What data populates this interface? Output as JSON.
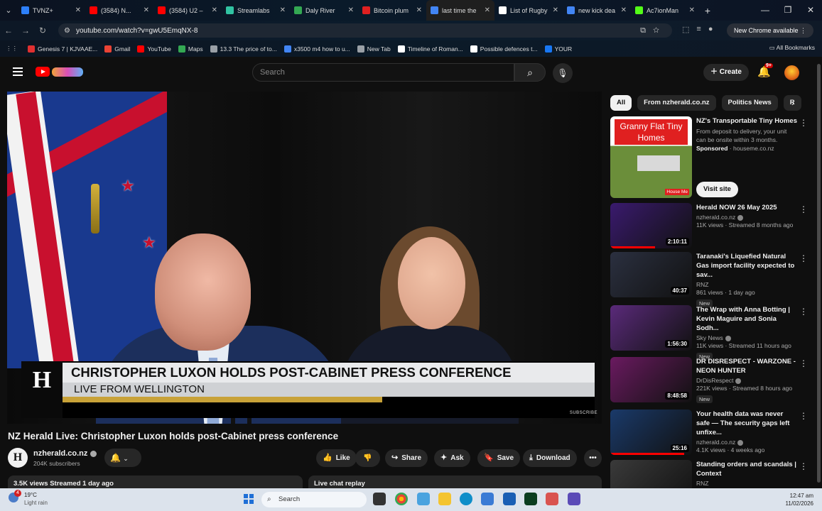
{
  "browser": {
    "tabs": [
      {
        "title": "TVNZ+",
        "color": "#2d7ff9"
      },
      {
        "title": "(3584) N...",
        "color": "#ff0000"
      },
      {
        "title": "(3584) U2 –",
        "color": "#ff0000"
      },
      {
        "title": "Streamlabs",
        "color": "#31c3a2"
      },
      {
        "title": "Daly River",
        "color": "#34a853"
      },
      {
        "title": "Bitcoin plum",
        "color": "#e02020"
      },
      {
        "title": "last time the",
        "color": "#4285f4"
      },
      {
        "title": "List of Rugby",
        "color": "#ffffff"
      },
      {
        "title": "new kick dea",
        "color": "#4285f4"
      },
      {
        "title": "Ac7ionMan",
        "color": "#53fc18"
      }
    ],
    "url": "youtube.com/watch?v=gwU5EmqNX-8",
    "new_chrome_label": "New Chrome available",
    "bookmarks": [
      {
        "label": "Genesis 7 | KJVAAE...",
        "color": "#e03030"
      },
      {
        "label": "Gmail",
        "color": "#ea4335"
      },
      {
        "label": "YouTube",
        "color": "#ff0000"
      },
      {
        "label": "Maps",
        "color": "#34a853"
      },
      {
        "label": "13.3 The price of to...",
        "color": "#9aa0a6"
      },
      {
        "label": "x3500 m4 how to u...",
        "color": "#4285f4"
      },
      {
        "label": "New Tab",
        "color": "#9aa0a6"
      },
      {
        "label": "Timeline of Roman...",
        "color": "#ffffff"
      },
      {
        "label": "Possible defences t...",
        "color": "#ffffff"
      },
      {
        "label": "YOUR",
        "color": "#1877f2"
      }
    ],
    "all_bookmarks_label": "All Bookmarks"
  },
  "youtube": {
    "search_placeholder": "Search",
    "create_label": "Create",
    "notifications_badge": "9+",
    "player": {
      "headline": "CHRISTOPHER LUXON HOLDS POST-CABINET PRESS CONFERENCE",
      "subheadline": "LIVE FROM WELLINGTON",
      "watermark": "SUBSCRIBE",
      "logo_letter": "H"
    },
    "video": {
      "title": "NZ Herald Live: Christopher Luxon holds post-Cabinet press conference",
      "channel": "nzherald.co.nz",
      "subscribers": "204K subscribers",
      "views_line": "3.5K views  Streamed 1 day ago",
      "live_chat_label": "Live chat replay"
    },
    "actions": {
      "like": "Like",
      "share": "Share",
      "ask": "Ask",
      "save": "Save",
      "download": "Download"
    },
    "chips": [
      "All",
      "From nzherald.co.nz",
      "Politics News",
      "R"
    ],
    "ad": {
      "banner": "Granny Flat Tiny Homes",
      "brand_tag": "House Me",
      "title": "NZ's Transportable Tiny Homes",
      "desc": "From deposit to delivery, your unit can be onsite within 3 months.",
      "sponsored": "Sponsored",
      "domain": "houseme.co.nz",
      "cta": "Visit site"
    },
    "recommendations": [
      {
        "title": "Herald NOW 26 May 2025",
        "channel": "nzherald.co.nz",
        "verified": true,
        "stats": "11K views · Streamed 8 months ago",
        "duration": "2:10:11",
        "new": false,
        "thumb": "#3a1a6e",
        "progress": 0.55
      },
      {
        "title": "Taranaki's Liquefied Natural Gas import facility expected to sav...",
        "channel": "RNZ",
        "verified": false,
        "stats": "861 views · 1 day ago",
        "duration": "40:37",
        "new": true,
        "thumb": "#2b3040",
        "progress": 0
      },
      {
        "title": "The Wrap with Anna Botting | Kevin Maguire and Sonia Sodh...",
        "channel": "Sky News",
        "verified": true,
        "stats": "11K views · Streamed 11 hours ago",
        "duration": "1:56:30",
        "new": true,
        "thumb": "#5a2a7a",
        "progress": 0
      },
      {
        "title": "DR DISRESPECT - WARZONE - NEON HUNTER",
        "channel": "DrDisRespect",
        "verified": true,
        "stats": "221K views · Streamed 8 hours ago",
        "duration": "8:48:58",
        "new": true,
        "thumb": "#6a1a60",
        "progress": 0
      },
      {
        "title": "Your health data was never safe — The security gaps left unfixe...",
        "channel": "nzherald.co.nz",
        "verified": true,
        "stats": "4.1K views · 4 weeks ago",
        "duration": "25:16",
        "new": false,
        "thumb": "#1a3a6a",
        "progress": 0.9
      },
      {
        "title": "Standing orders and scandals | Context",
        "channel": "RNZ",
        "verified": false,
        "stats": "",
        "duration": "",
        "new": false,
        "thumb": "#3a3a3a",
        "progress": 0
      }
    ]
  },
  "taskbar": {
    "weather_temp": "19°C",
    "weather_desc": "Light rain",
    "weather_badge": "4",
    "search_label": "Search",
    "time": "12:47 am",
    "date": "11/02/2026"
  }
}
